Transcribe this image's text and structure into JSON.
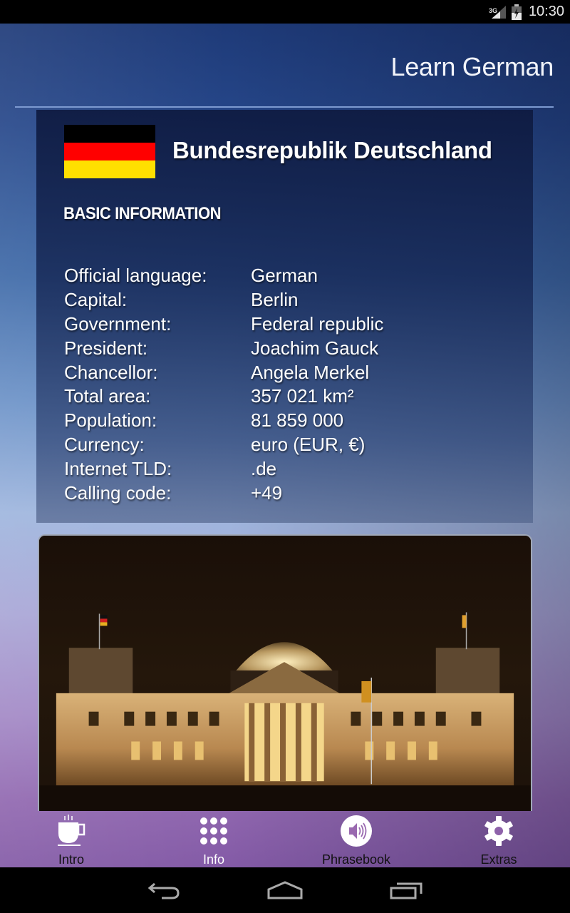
{
  "status_bar": {
    "network_type": "3G",
    "time": "10:30",
    "icons": [
      "signal-icon",
      "battery-charging-icon"
    ]
  },
  "app": {
    "title": "Learn German"
  },
  "country": {
    "name": "Bundesrepublik Deutschland",
    "flag_colors": [
      "#000000",
      "#FF0000",
      "#FFE000"
    ],
    "section_heading": "BASIC INFORMATION",
    "facts": [
      {
        "label": "Official language:",
        "value": "German"
      },
      {
        "label": "Capital:",
        "value": "Berlin"
      },
      {
        "label": "Government:",
        "value": "Federal republic"
      },
      {
        "label": "President:",
        "value": "Joachim Gauck"
      },
      {
        "label": "Chancellor:",
        "value": "Angela Merkel"
      },
      {
        "label": "Total area:",
        "value": "357 021 km²"
      },
      {
        "label": "Population:",
        "value": "81 859 000"
      },
      {
        "label": "Currency:",
        "value": "euro (EUR, €)"
      },
      {
        "label": "Internet TLD:",
        "value": ".de"
      },
      {
        "label": "Calling code:",
        "value": "+49"
      }
    ],
    "photo": {
      "subject": "Reichstag building at night",
      "icon": "photo-image"
    }
  },
  "tabs": [
    {
      "label": "Intro",
      "icon": "coffee-cup-icon",
      "active": false
    },
    {
      "label": "Info",
      "icon": "grid-dots-icon",
      "active": true
    },
    {
      "label": "Phrasebook",
      "icon": "speaker-icon",
      "active": false
    },
    {
      "label": "Extras",
      "icon": "gear-icon",
      "active": false
    }
  ],
  "nav_bar": {
    "buttons": [
      "back-icon",
      "home-icon",
      "recent-apps-icon"
    ]
  },
  "colors": {
    "tab_active_label": "#FFFFFF",
    "tab_inactive_label": "#111111",
    "title_divider": "#7D9AD0"
  }
}
